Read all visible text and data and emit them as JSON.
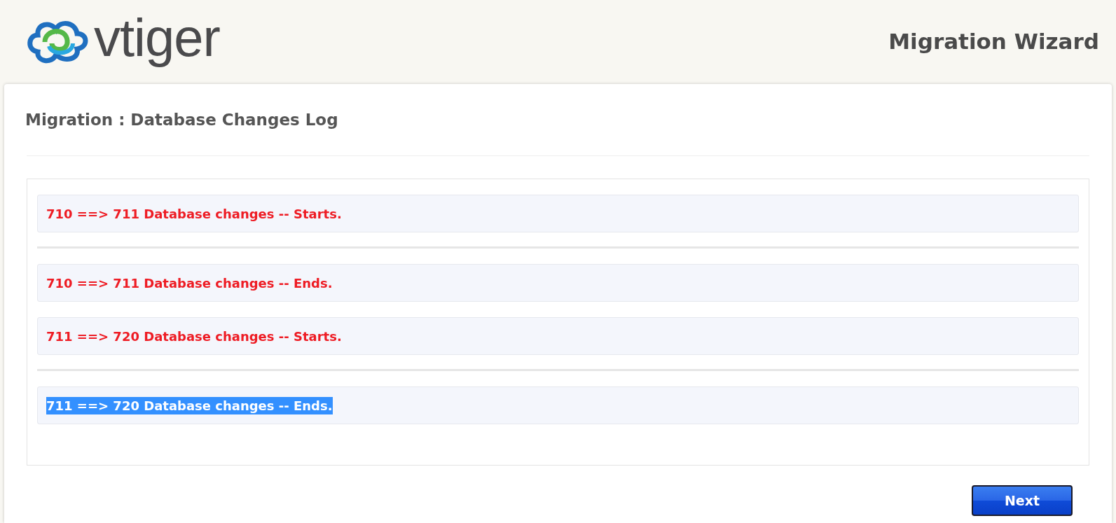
{
  "header": {
    "logo_text": "vtiger",
    "title": "Migration Wizard"
  },
  "panel": {
    "heading": "Migration : Database Changes Log",
    "log_items": [
      {
        "kind": "entry",
        "text": "710 ==> 711 Database changes -- Starts.",
        "highlighted": false
      },
      {
        "kind": "divider"
      },
      {
        "kind": "entry",
        "text": "710 ==> 711 Database changes -- Ends.",
        "highlighted": false
      },
      {
        "kind": "entry",
        "text": "711 ==> 720 Database changes -- Starts.",
        "highlighted": false
      },
      {
        "kind": "divider"
      },
      {
        "kind": "entry",
        "text": "711 ==> 720 Database changes -- Ends.",
        "highlighted": true
      }
    ],
    "next_button": "Next"
  }
}
